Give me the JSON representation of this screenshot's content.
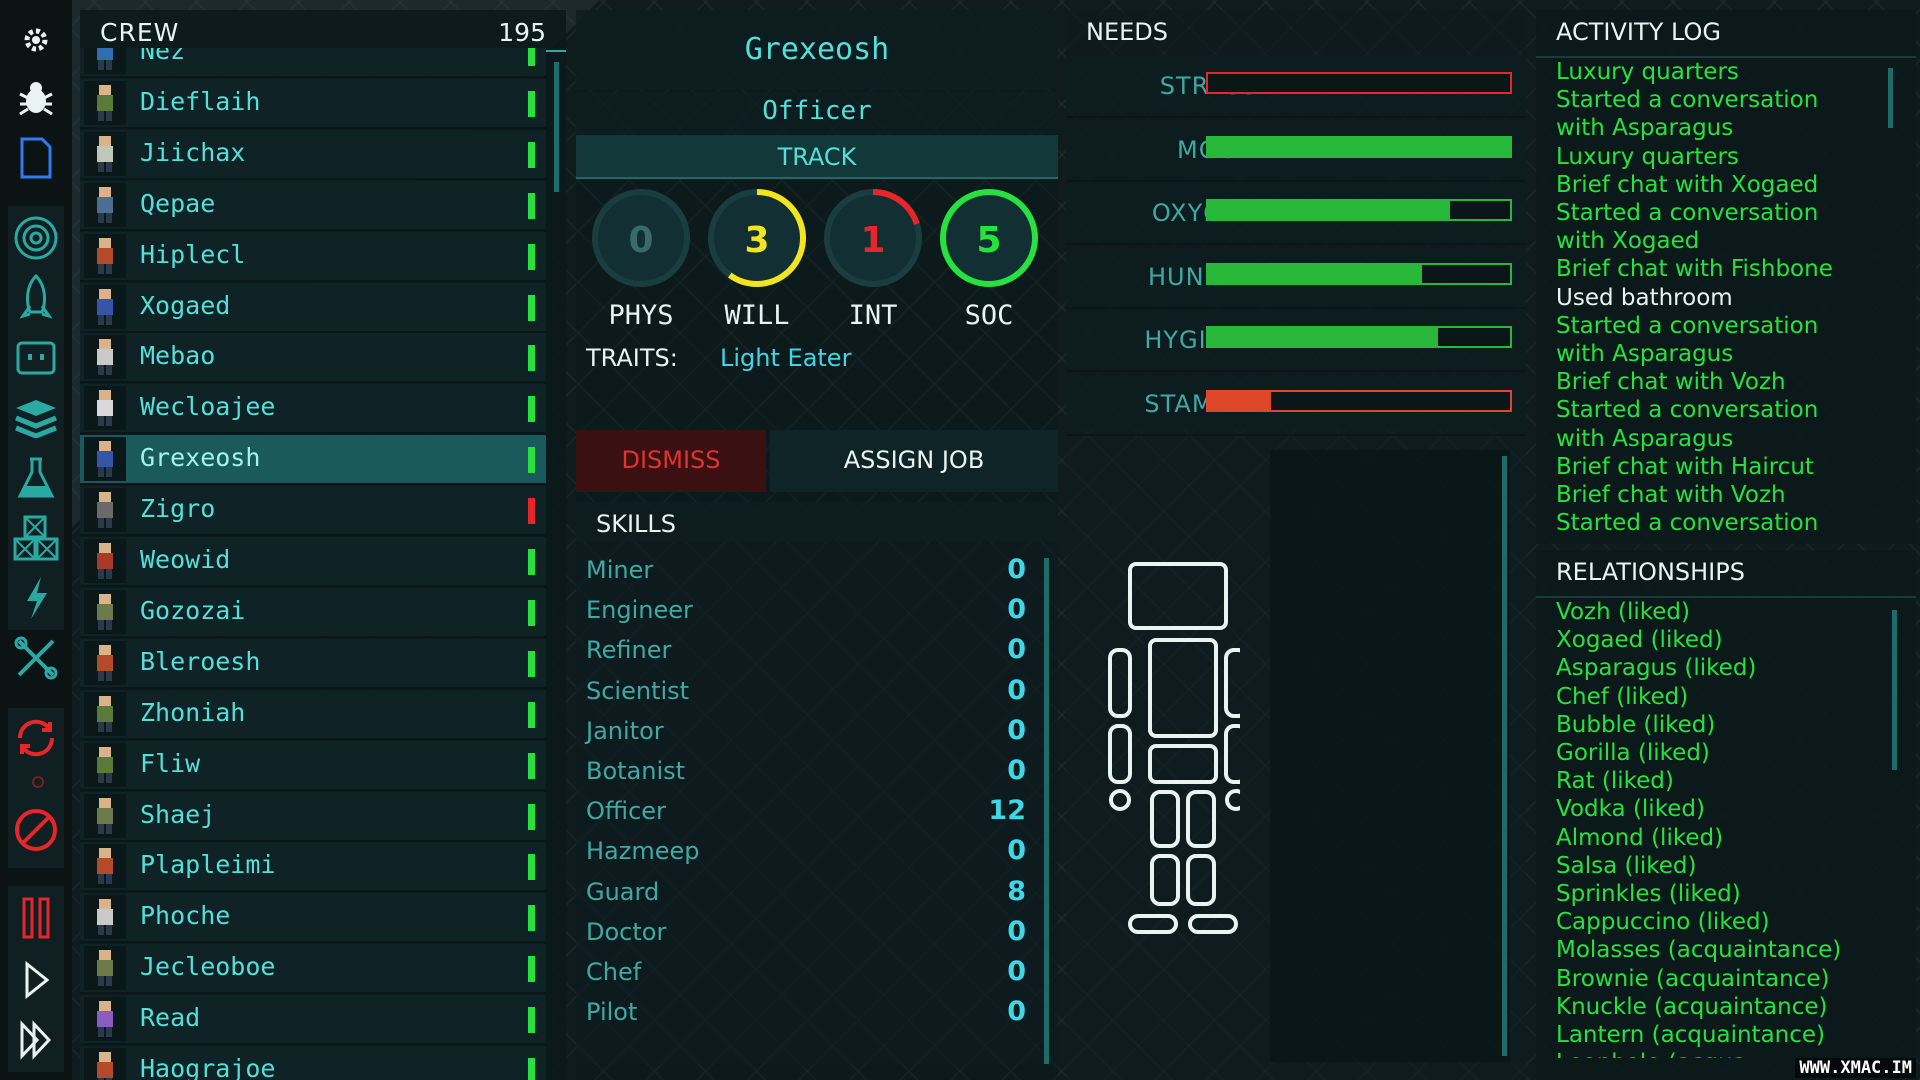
{
  "crew": {
    "title": "CREW",
    "count": "195",
    "members": [
      {
        "name": "Nez",
        "status": "ok"
      },
      {
        "name": "Dieflaih",
        "status": "ok"
      },
      {
        "name": "Jiichax",
        "status": "ok"
      },
      {
        "name": "Qepae",
        "status": "ok"
      },
      {
        "name": "Hiplecl",
        "status": "ok"
      },
      {
        "name": "Xogaed",
        "status": "ok"
      },
      {
        "name": "Mebao",
        "status": "ok"
      },
      {
        "name": "Wecloajee",
        "status": "ok"
      },
      {
        "name": "Grexeosh",
        "status": "ok",
        "selected": true
      },
      {
        "name": "Zigro",
        "status": "alert"
      },
      {
        "name": "Weowid",
        "status": "ok"
      },
      {
        "name": "Gozozai",
        "status": "ok"
      },
      {
        "name": "Bleroesh",
        "status": "ok"
      },
      {
        "name": "Zhoniah",
        "status": "ok"
      },
      {
        "name": "Fliw",
        "status": "ok"
      },
      {
        "name": "Shaej",
        "status": "ok"
      },
      {
        "name": "Plapleimi",
        "status": "ok"
      },
      {
        "name": "Phoche",
        "status": "ok"
      },
      {
        "name": "Jecleoboe",
        "status": "ok"
      },
      {
        "name": "Read",
        "status": "ok"
      },
      {
        "name": "Haograjoe",
        "status": "ok"
      }
    ]
  },
  "detail": {
    "name": "Grexeosh",
    "role": "Officer",
    "track_label": "TRACK",
    "stats": [
      {
        "label": "PHYS",
        "value": "0",
        "color": "#3b6a6a",
        "fraction": 0
      },
      {
        "label": "WILL",
        "value": "3",
        "color": "#f2e41e",
        "fraction": 0.6
      },
      {
        "label": "INT",
        "value": "1",
        "color": "#e8252a",
        "fraction": 0.2
      },
      {
        "label": "SOC",
        "value": "5",
        "color": "#27e23e",
        "fraction": 1.0
      }
    ],
    "traits_label": "TRAITS:",
    "traits_value": "Light Eater",
    "dismiss_label": "DISMISS",
    "assign_label": "ASSIGN JOB",
    "skills_title": "SKILLS",
    "skills": [
      {
        "name": "Miner",
        "value": "0"
      },
      {
        "name": "Engineer",
        "value": "0"
      },
      {
        "name": "Refiner",
        "value": "0"
      },
      {
        "name": "Scientist",
        "value": "0"
      },
      {
        "name": "Janitor",
        "value": "0"
      },
      {
        "name": "Botanist",
        "value": "0"
      },
      {
        "name": "Officer",
        "value": "12"
      },
      {
        "name": "Hazmeep",
        "value": "0"
      },
      {
        "name": "Guard",
        "value": "8"
      },
      {
        "name": "Doctor",
        "value": "0"
      },
      {
        "name": "Chef",
        "value": "0"
      },
      {
        "name": "Pilot",
        "value": "0"
      }
    ]
  },
  "needs": {
    "title": "NEEDS",
    "items": [
      {
        "label": "STRESS",
        "level": 0.0,
        "color": "#e8252a"
      },
      {
        "label": "MOOD",
        "level": 1.0,
        "color": "#27b83a"
      },
      {
        "label": "OXYGEN",
        "level": 0.8,
        "color": "#27b83a"
      },
      {
        "label": "HUNGER",
        "level": 0.71,
        "color": "#27b83a"
      },
      {
        "label": "HYGIENE",
        "level": 0.76,
        "color": "#27b83a"
      },
      {
        "label": "STAMINA",
        "level": 0.21,
        "color": "#e0462a"
      }
    ]
  },
  "activity": {
    "title": "ACTIVITY LOG",
    "lines": [
      {
        "text": "Luxury quarters"
      },
      {
        "text": "Started a conversation"
      },
      {
        "text": "with Asparagus"
      },
      {
        "text": "Luxury quarters"
      },
      {
        "text": "Brief chat with Xogaed"
      },
      {
        "text": "Started a conversation"
      },
      {
        "text": "with Xogaed"
      },
      {
        "text": "Brief chat with Fishbone"
      },
      {
        "text": "Used bathroom",
        "white": true
      },
      {
        "text": "Started a conversation"
      },
      {
        "text": "with Asparagus"
      },
      {
        "text": "Brief chat with Vozh"
      },
      {
        "text": "Started a conversation"
      },
      {
        "text": "with Asparagus"
      },
      {
        "text": "Brief chat with Haircut"
      },
      {
        "text": "Brief chat with Vozh"
      },
      {
        "text": "Started a conversation"
      }
    ]
  },
  "relationships": {
    "title": "RELATIONSHIPS",
    "lines": [
      "Vozh (liked)",
      "Xogaed (liked)",
      "Asparagus (liked)",
      "Chef (liked)",
      "Bubble (liked)",
      "Gorilla (liked)",
      "Rat (liked)",
      "Vodka (liked)",
      "Almond (liked)",
      "Salsa (liked)",
      "Sprinkles (liked)",
      "Cappuccino (liked)",
      "Molasses (acquaintance)",
      "Brownie (acquaintance)",
      "Knuckle (acquaintance)",
      "Lantern (acquaintance)",
      "Leophole (acqua"
    ]
  },
  "toolbar": {
    "icons": [
      "gear-icon",
      "bug-icon",
      "document-icon",
      "target-icon",
      "rocket-icon",
      "robot-icon",
      "layers-icon",
      "flask-icon",
      "crates-icon",
      "lightning-icon",
      "tools-icon",
      "refresh-icon",
      "cancel-icon",
      "pause-icon",
      "play-icon",
      "fast-forward-icon"
    ]
  },
  "watermark": "WWW.XMAC.IM"
}
